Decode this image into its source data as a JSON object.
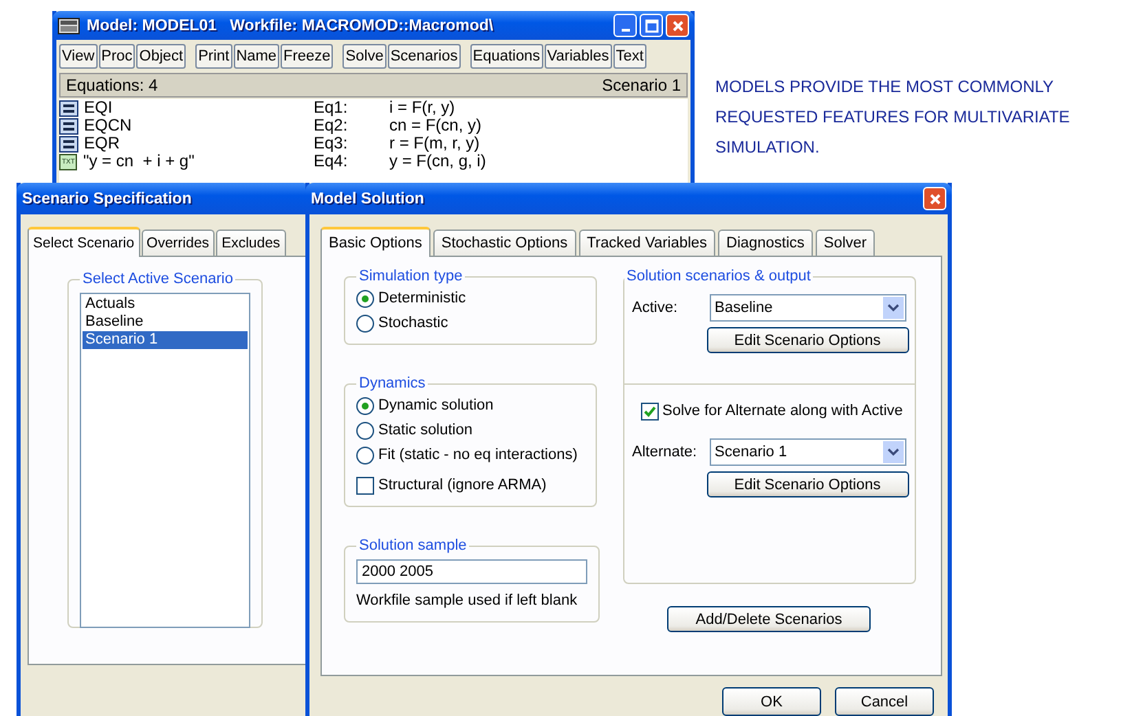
{
  "model_window": {
    "title": "Model: MODEL01   Workfile: MACROMOD::Macromod\\",
    "toolbar": [
      [
        "View",
        "Proc",
        "Object"
      ],
      [
        "Print",
        "Name",
        "Freeze"
      ],
      [
        "Solve",
        "Scenarios"
      ],
      [
        "Equations",
        "Variables",
        "Text"
      ]
    ],
    "header": {
      "count": "Equations: 4",
      "scenario": "Scenario 1"
    },
    "items": [
      {
        "kind": "equation",
        "name": "EQI",
        "label": "Eq1:",
        "formula": "i = F(r, y)"
      },
      {
        "kind": "equation",
        "name": "EQCN",
        "label": "Eq2:",
        "formula": "cn = F(cn, y)"
      },
      {
        "kind": "equation",
        "name": "EQR",
        "label": "Eq3:",
        "formula": "r = F(m, r, y)"
      },
      {
        "kind": "text",
        "badge": "TXT",
        "name": "\"y = cn  + i + g\"",
        "label": "Eq4:",
        "formula": "y = F(cn, g, i)"
      }
    ]
  },
  "caption": "MODELS PROVIDE THE MOST COMMONLY REQUESTED FEATURES FOR  MULTIVARIATE SIMULATION.",
  "scenario_window": {
    "title": "Scenario Specification",
    "tabs": [
      {
        "label": "Select Scenario",
        "selected": true
      },
      {
        "label": "Overrides",
        "selected": false
      },
      {
        "label": "Excludes",
        "selected": false
      }
    ],
    "group_title": "Select Active Scenario",
    "scenarios": [
      {
        "label": "Actuals",
        "selected": false
      },
      {
        "label": "Baseline",
        "selected": false
      },
      {
        "label": "Scenario 1",
        "selected": true
      }
    ]
  },
  "solution_window": {
    "title": "Model Solution",
    "tabs": [
      {
        "label": "Basic Options",
        "selected": true
      },
      {
        "label": "Stochastic Options",
        "selected": false
      },
      {
        "label": "Tracked Variables",
        "selected": false
      },
      {
        "label": "Diagnostics",
        "selected": false
      },
      {
        "label": "Solver",
        "selected": false
      }
    ],
    "simulation_type": {
      "title": "Simulation type",
      "options": [
        {
          "label": "Deterministic",
          "selected": true
        },
        {
          "label": "Stochastic",
          "selected": false
        }
      ]
    },
    "dynamics": {
      "title": "Dynamics",
      "options": [
        {
          "label": "Dynamic solution",
          "selected": true
        },
        {
          "label": "Static solution",
          "selected": false
        },
        {
          "label": "Fit (static - no eq interactions)",
          "selected": false
        }
      ],
      "structural": {
        "label": "Structural (ignore ARMA)",
        "checked": false
      }
    },
    "sample": {
      "title": "Solution sample",
      "value": "2000 2005",
      "hint": "Workfile sample used if left blank"
    },
    "scenarios": {
      "title": "Solution scenarios & output",
      "active_label": "Active:",
      "active_value": "Baseline",
      "edit_button": "Edit Scenario Options",
      "solve_alternate": {
        "label": "Solve for Alternate along with Active",
        "checked": true
      },
      "alternate_label": "Alternate:",
      "alternate_value": "Scenario 1",
      "edit_button_2": "Edit Scenario Options"
    },
    "add_delete_button": "Add/Delete Scenarios",
    "buttons": [
      "OK",
      "Cancel"
    ]
  }
}
